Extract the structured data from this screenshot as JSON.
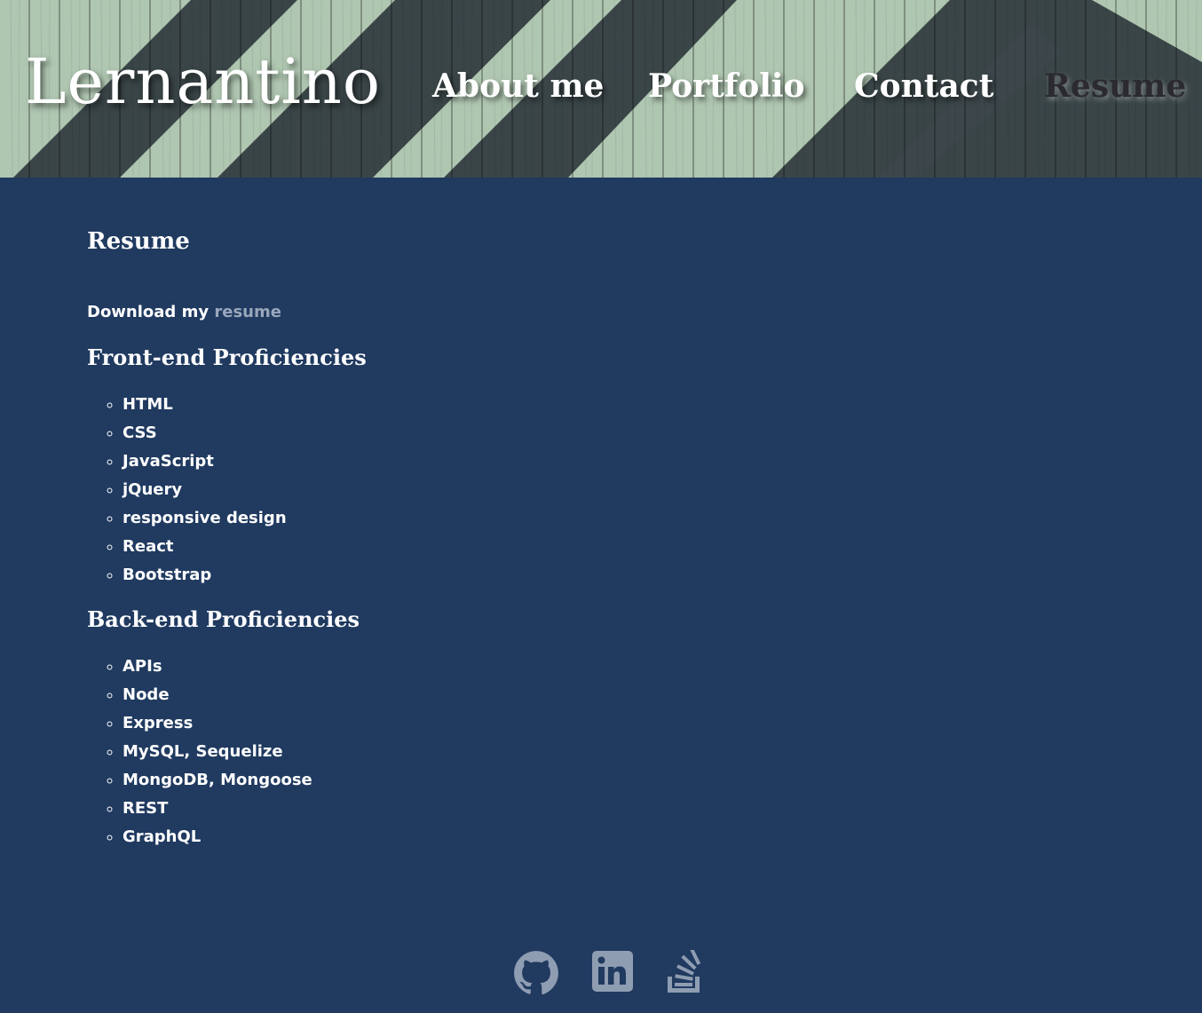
{
  "header": {
    "brand": "Lernantino",
    "nav": [
      {
        "label": "About me",
        "active": false
      },
      {
        "label": "Portfolio",
        "active": false
      },
      {
        "label": "Contact",
        "active": false
      },
      {
        "label": "Resume",
        "active": true
      }
    ]
  },
  "main": {
    "title": "Resume",
    "download_prefix": "Download my",
    "download_link": "resume",
    "front_end": {
      "title": "Front-end Proficiencies",
      "items": [
        "HTML",
        "CSS",
        "JavaScript",
        "jQuery",
        "responsive design",
        "React",
        "Bootstrap"
      ]
    },
    "back_end": {
      "title": "Back-end Proficiencies",
      "items": [
        "APIs",
        "Node",
        "Express",
        "MySQL, Sequelize",
        "MongoDB, Mongoose",
        "REST",
        "GraphQL"
      ]
    }
  },
  "footer": {
    "icons": [
      "github-icon",
      "linkedin-icon",
      "stackoverflow-icon"
    ]
  },
  "colors": {
    "background": "#203a60",
    "text": "#ffffff",
    "link": "#9aa7bb",
    "active_nav": "#2b2a30",
    "icon": "#8f9db2"
  }
}
